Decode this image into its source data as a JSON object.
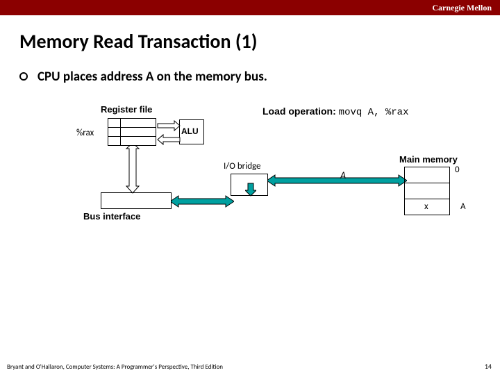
{
  "header": {
    "org": "Carnegie Mellon"
  },
  "slide": {
    "title": "Memory Read Transaction (1)",
    "bullet": "CPU places address A on the memory bus."
  },
  "diagram": {
    "regfile_label": "Register file",
    "rax": "%rax",
    "alu": "ALU",
    "load_op_prefix": "Load operation: ",
    "load_op_code": "movq A, %rax",
    "io_bridge": "I/O bridge",
    "bus_interface": "Bus interface",
    "main_memory": "Main memory",
    "mem_zero": "0",
    "mem_x": "x",
    "mem_A": "A",
    "bus_A": "A"
  },
  "footer": {
    "credit": "Bryant and O'Hallaron, Computer Systems: A Programmer's Perspective, Third Edition",
    "page": "14"
  },
  "colors": {
    "header_bg": "#8b0000",
    "bus_fill": "#00a0a0"
  }
}
